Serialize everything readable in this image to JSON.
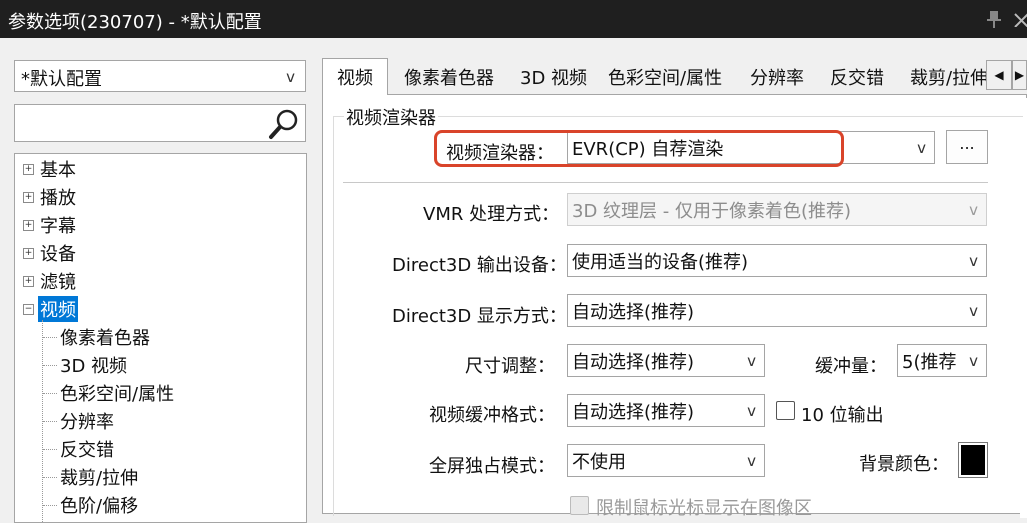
{
  "window": {
    "title": "参数选项(230707) - *默认配置"
  },
  "sidebar": {
    "profile_value": "*默认配置",
    "search_value": "",
    "tree": [
      {
        "label": "基本",
        "expander": "+"
      },
      {
        "label": "播放",
        "expander": "+"
      },
      {
        "label": "字幕",
        "expander": "+"
      },
      {
        "label": "设备",
        "expander": "+"
      },
      {
        "label": "滤镜",
        "expander": "+"
      },
      {
        "label": "视频",
        "expander": "−",
        "selected": true
      }
    ],
    "children": [
      "像素着色器",
      "3D 视频",
      "色彩空间/属性",
      "分辨率",
      "反交错",
      "裁剪/拉伸",
      "色阶/偏移"
    ]
  },
  "tabs": [
    "视频",
    "像素着色器",
    "3D 视频",
    "色彩空间/属性",
    "分辨率",
    "反交错",
    "裁剪/拉伸"
  ],
  "group": {
    "title": "视频渲染器"
  },
  "fields": {
    "renderer": {
      "label": "视频渲染器：",
      "value": "EVR(CP) 自荐渲染"
    },
    "more_button": "...",
    "vmr": {
      "label": "VMR 处理方式：",
      "value": "3D 纹理层 - 仅用于像素着色(推荐)"
    },
    "d3d_device": {
      "label": "Direct3D 输出设备：",
      "value": "使用适当的设备(推荐)"
    },
    "d3d_display": {
      "label": "Direct3D 显示方式：",
      "value": "自动选择(推荐)"
    },
    "resize": {
      "label": "尺寸调整：",
      "value": "自动选择(推荐)"
    },
    "buffer": {
      "label": "缓冲量：",
      "value": "5(推荐"
    },
    "buffer_format": {
      "label": "视频缓冲格式：",
      "value": "自动选择(推荐)"
    },
    "ten_bit": {
      "label": "10 位输出"
    },
    "fullscreen": {
      "label": "全屏独占模式：",
      "value": "不使用"
    },
    "bg_color": {
      "label": "背景颜色：",
      "color": "#000000"
    },
    "cursor_limit": {
      "label": "限制鼠标光标显示在图像区"
    }
  },
  "colors": {
    "accent": "#0078d7",
    "highlight": "#d9442a",
    "titlebar": "#1f1f1f"
  },
  "icons": {
    "chevron": "v",
    "scroll_left": "◀",
    "scroll_right": "▶"
  }
}
